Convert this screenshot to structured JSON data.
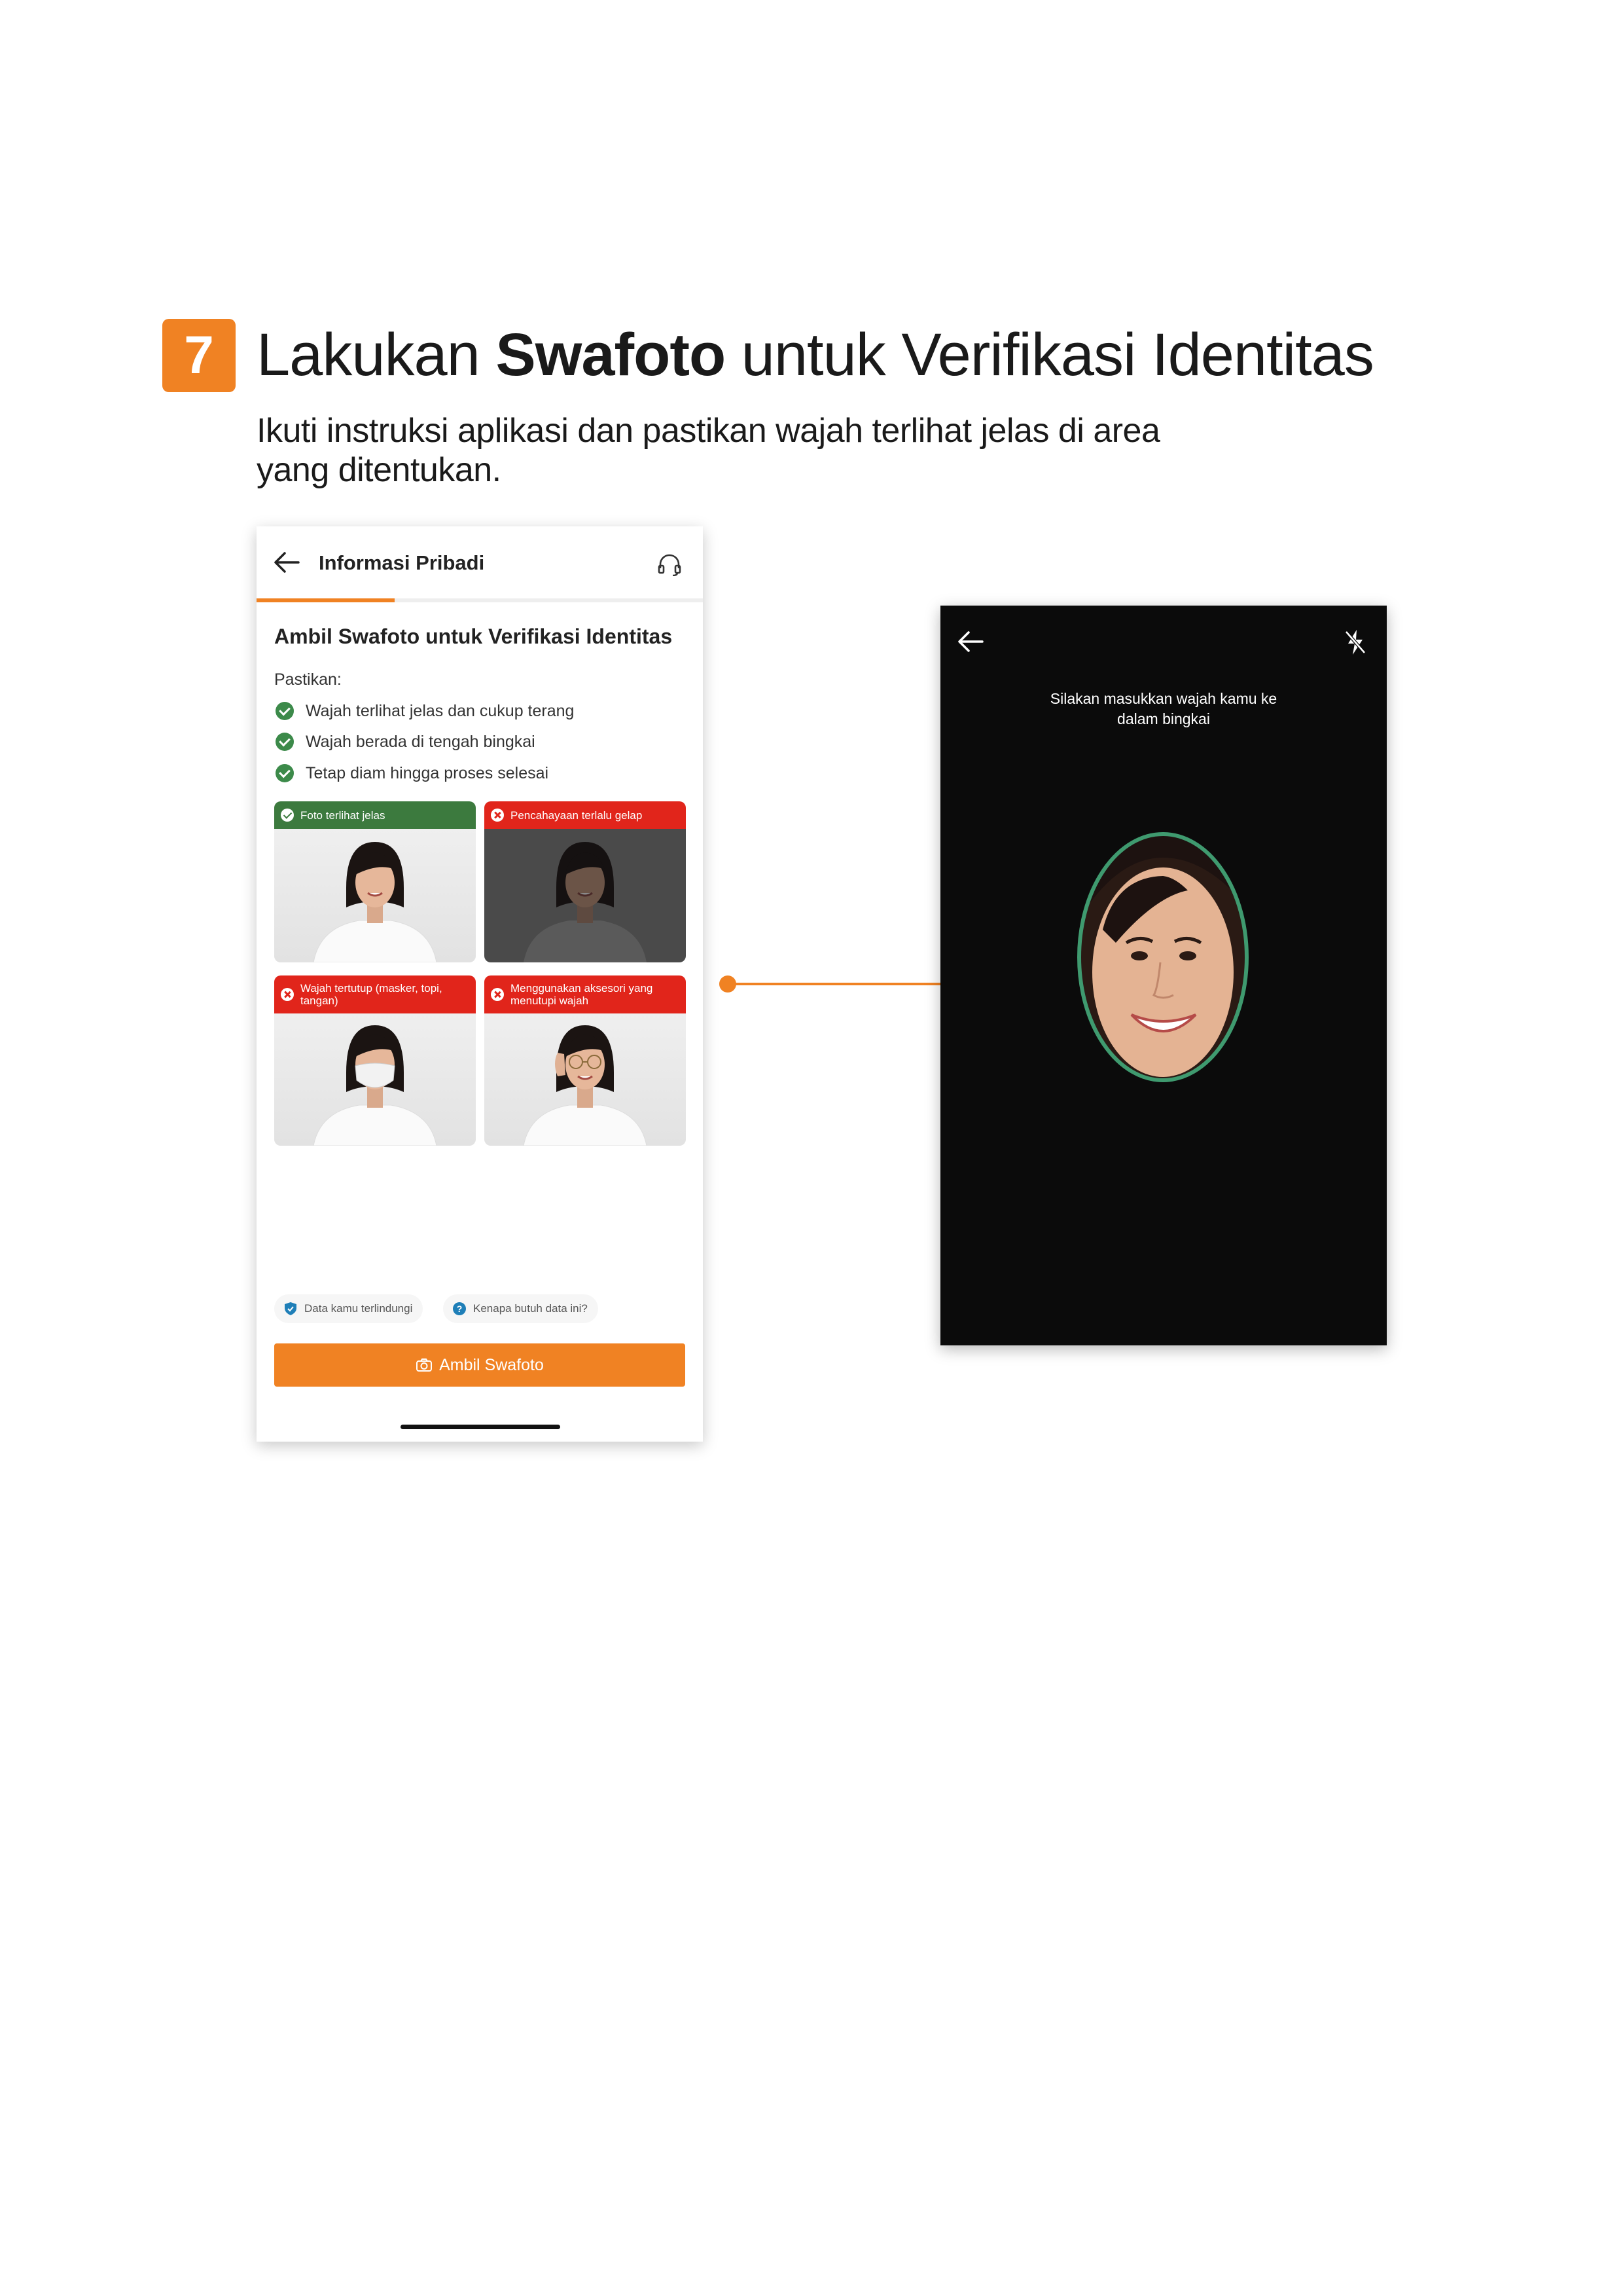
{
  "step": {
    "number": "7",
    "title_pre": "Lakukan ",
    "title_bold": "Swafoto",
    "title_post": " untuk Verifikasi Identitas",
    "subtitle": "Ikuti instruksi aplikasi dan pastikan wajah terlihat jelas di area yang ditentukan."
  },
  "phone1": {
    "header_title": "Informasi Pribadi",
    "progress_fraction": 0.31,
    "heading": "Ambil Swafoto untuk Verifikasi Identitas",
    "checklist_label": "Pastikan:",
    "checklist": [
      "Wajah terlihat jelas dan cukup terang",
      "Wajah berada di tengah bingkai",
      "Tetap diam hingga proses selesai"
    ],
    "examples": [
      {
        "label": "Foto terlihat jelas",
        "status": "ok"
      },
      {
        "label": "Pencahayaan terlalu gelap",
        "status": "bad"
      },
      {
        "label": "Wajah tertutup (masker, topi, tangan)",
        "status": "bad"
      },
      {
        "label": "Menggunakan aksesori yang menutupi wajah",
        "status": "bad"
      }
    ],
    "chips": [
      "Data kamu terlindungi",
      "Kenapa butuh data ini?"
    ],
    "cta_label": "Ambil Swafoto"
  },
  "phone2": {
    "instruction": "Silakan masukkan wajah kamu ke dalam bingkai"
  },
  "colors": {
    "accent": "#f08223",
    "success": "#3c7a3e",
    "error": "#e1251b",
    "camera_bg": "#0b0b0b",
    "frame": "#3f9a6f"
  },
  "icons": [
    "back-arrow-icon",
    "headset-icon",
    "check-icon",
    "cross-icon",
    "shield-icon",
    "question-icon",
    "camera-icon",
    "flash-off-icon"
  ]
}
